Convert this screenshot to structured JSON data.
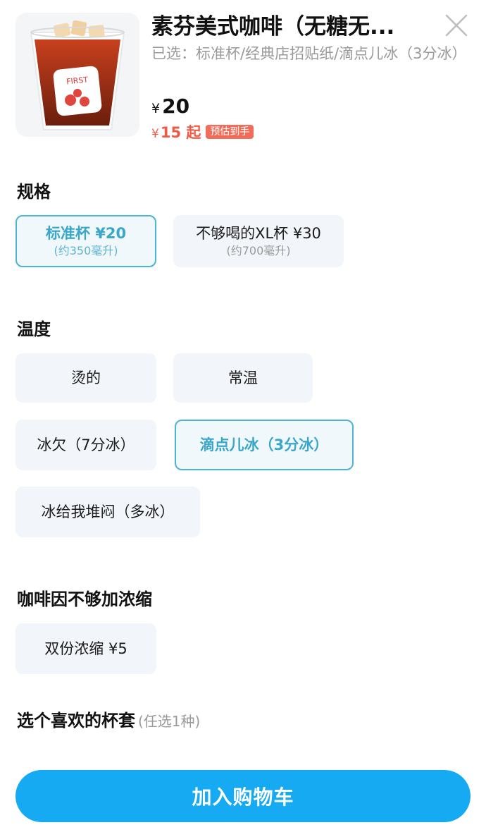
{
  "product": {
    "title": "素芬美式咖啡（无糖无...",
    "selected_text": "已选：标准杯/经典店招贴纸/滴点儿冰（3分冰）",
    "currency": "¥",
    "price": "20",
    "est_price": "15",
    "est_suffix": "起",
    "est_badge": "预估到手",
    "image_icon": "iced-americano-cup"
  },
  "sections": {
    "size": {
      "title": "规格",
      "options": [
        {
          "label": "标准杯 ¥20",
          "sub": "(约350毫升)",
          "selected": true
        },
        {
          "label": "不够喝的XL杯 ¥30",
          "sub": "(约700毫升)",
          "selected": false
        }
      ]
    },
    "temperature": {
      "title": "温度",
      "options": [
        {
          "label": "烫的",
          "selected": false
        },
        {
          "label": "常温",
          "selected": false
        },
        {
          "label": "冰欠（7分冰）",
          "selected": false
        },
        {
          "label": "滴点儿冰（3分冰）",
          "selected": true
        },
        {
          "label": "冰给我堆闷（多冰）",
          "selected": false
        }
      ]
    },
    "espresso": {
      "title": "咖啡因不够加浓缩",
      "options": [
        {
          "label": "双份浓缩 ¥5",
          "selected": false
        }
      ]
    },
    "sleeve": {
      "title": "选个喜欢的杯套",
      "hint": "(任选1种)"
    }
  },
  "cart_button": {
    "label": "加入购物车"
  },
  "colors": {
    "accent": "#16aaf2",
    "selected_border": "#4cb4d4",
    "price_red": "#f05a45",
    "option_bg": "#f2f6fa"
  }
}
